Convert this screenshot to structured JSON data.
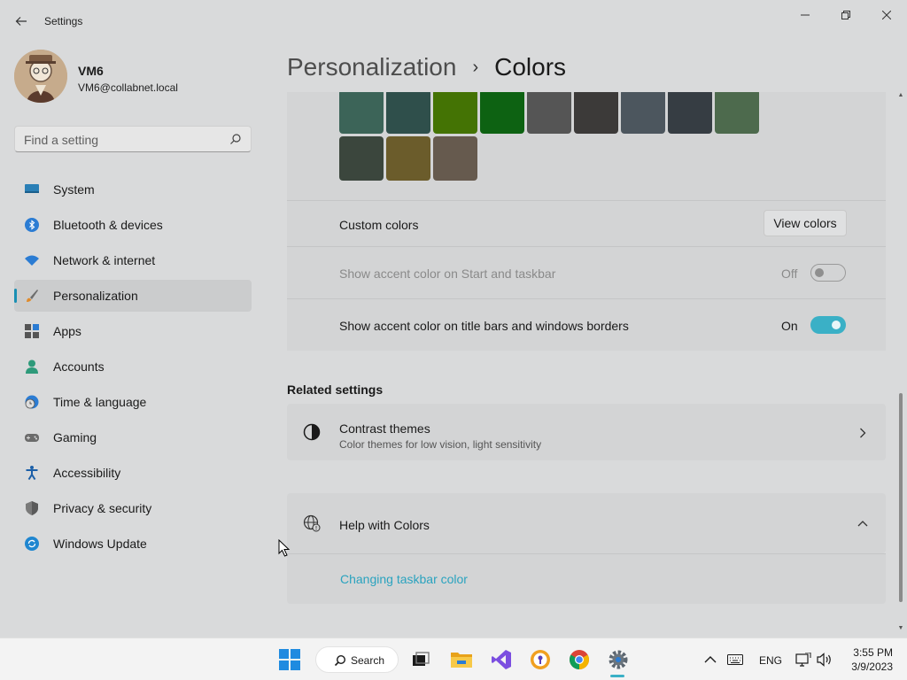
{
  "window": {
    "title": "Settings"
  },
  "profile": {
    "name": "VM6",
    "email": "VM6@collabnet.local"
  },
  "search": {
    "placeholder": "Find a setting"
  },
  "nav": {
    "items": [
      {
        "label": "System",
        "icon": "system-icon",
        "active": false
      },
      {
        "label": "Bluetooth & devices",
        "icon": "bluetooth-icon",
        "active": false
      },
      {
        "label": "Network & internet",
        "icon": "wifi-icon",
        "active": false
      },
      {
        "label": "Personalization",
        "icon": "brush-icon",
        "active": true
      },
      {
        "label": "Apps",
        "icon": "apps-icon",
        "active": false
      },
      {
        "label": "Accounts",
        "icon": "person-icon",
        "active": false
      },
      {
        "label": "Time & language",
        "icon": "globe-clock-icon",
        "active": false
      },
      {
        "label": "Gaming",
        "icon": "gamepad-icon",
        "active": false
      },
      {
        "label": "Accessibility",
        "icon": "accessibility-icon",
        "active": false
      },
      {
        "label": "Privacy & security",
        "icon": "shield-icon",
        "active": false
      },
      {
        "label": "Windows Update",
        "icon": "update-icon",
        "active": false
      }
    ]
  },
  "breadcrumb": {
    "parent": "Personalization",
    "separator": "›",
    "current": "Colors"
  },
  "swatches": {
    "row1": [
      "#3c6458",
      "#2f4f4b",
      "#447304",
      "#0d6212",
      "#555555",
      "#3c3a39",
      "#4c565e",
      "#363d43",
      "#4d6a4d"
    ],
    "row2": [
      "#3b463d",
      "#6b5c2b",
      "#665a4e"
    ]
  },
  "custom_colors": {
    "label": "Custom colors",
    "button": "View colors"
  },
  "accent_start": {
    "label": "Show accent color on Start and taskbar",
    "state": "Off"
  },
  "accent_title": {
    "label": "Show accent color on title bars and windows borders",
    "state": "On"
  },
  "related": {
    "title": "Related settings",
    "contrast_title": "Contrast themes",
    "contrast_sub": "Color themes for low vision, light sensitivity"
  },
  "help": {
    "title": "Help with Colors",
    "link": "Changing taskbar color"
  },
  "taskbar": {
    "search_label": "Search",
    "language": "ENG",
    "time": "3:55 PM",
    "date": "3/9/2023"
  },
  "colors": {
    "accent": "#3ab0c6",
    "link": "#2aa3bf"
  }
}
